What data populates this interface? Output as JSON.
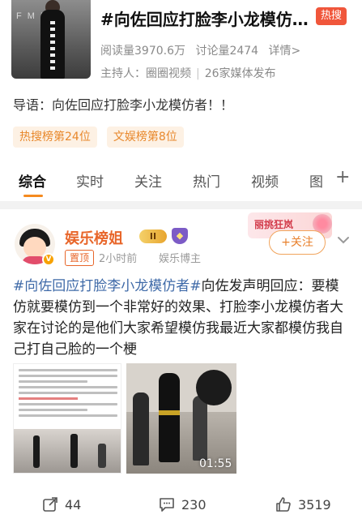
{
  "topic": {
    "cover_brand": "F M F E",
    "title": "#向佐回应打脸李小龙模仿者#",
    "hot_badge": "热搜",
    "reads": "阅读量3970.6万",
    "discussions": "讨论量2474",
    "details": "详情>",
    "host": "主持人：",
    "host_name": "圈圈视频",
    "media_count": "26家媒体发布"
  },
  "guide": "导语：向佐回应打脸李小龙模仿者！！",
  "ranks": [
    "热搜榜第24位",
    "文娱榜第8位"
  ],
  "tabs": [
    "综合",
    "实时",
    "关注",
    "热门",
    "视频",
    "图"
  ],
  "active_tab": 0,
  "post": {
    "author": "娱乐榜姐",
    "level": "II",
    "pin": "置顶",
    "time": "2小时前",
    "source": "娱乐博主",
    "promo": "丽挑狂岚",
    "follow": "+关注",
    "topic_link": "#向佐回应打脸李小龙模仿者#",
    "body": "向佐发声明回应：要模仿就要模仿到一个非常好的效果、打脸李小龙模仿者大家在讨论的是他们大家希望模仿我最近大家都模仿我自己打自己脸的一个梗",
    "video_duration": "01:55"
  },
  "actions": {
    "shares": "44",
    "comments": "230",
    "likes": "3519"
  },
  "colors": {
    "accent": "#f58a1f",
    "hot_badge": "#f0563b",
    "link": "#3f6aa8",
    "author": "#e8662a"
  }
}
